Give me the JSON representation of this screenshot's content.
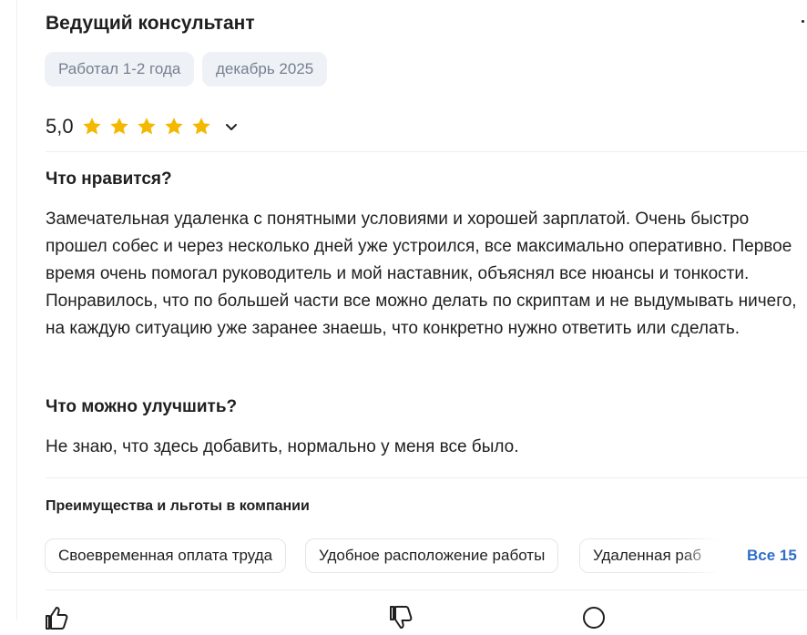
{
  "review": {
    "title": "Ведущий консультант",
    "tags": [
      "Работал 1-2 года",
      "декабрь 2025"
    ],
    "rating": {
      "value": "5,0",
      "stars": 5,
      "star_color": "#f5b800"
    },
    "likes_heading": "Что нравится?",
    "likes_text": "Замечательная удаленка с понятными условиями и хорошей зарплатой. Очень быстро прошел собес и через несколько дней уже устроился, все максимально оперативно. Первое время очень помогал руководитель и мой наставник, объяснял все нюансы и тонкости. Понравилось, что по большей части все можно делать по скриптам и не выдумывать ничего, на каждую ситуацию уже заранее знаешь, что конкретно нужно ответить или сделать.",
    "improve_heading": "Что можно улучшить?",
    "improve_text": "Не знаю, что здесь добавить, нормально у меня все было."
  },
  "benefits": {
    "heading": "Преимущества и льготы в компании",
    "items": [
      "Своевременная оплата труда",
      "Удобное расположение работы",
      "Удаленная раб"
    ],
    "all_link": "Все 15",
    "link_color": "#2f6ec8"
  },
  "icons": {
    "rating_expand": "chevron-down-icon",
    "footer": [
      "like-icon",
      "dislike-icon",
      "comment-icon"
    ]
  }
}
